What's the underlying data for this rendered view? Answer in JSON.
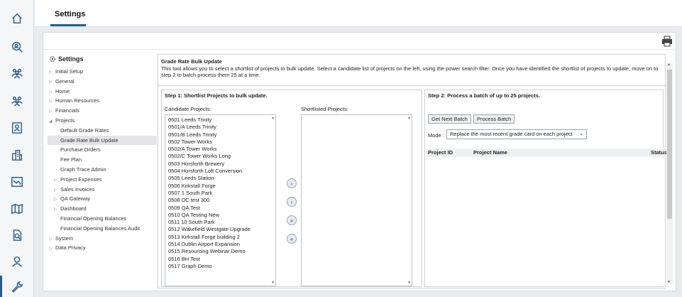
{
  "rail": {
    "icons": [
      "home-icon",
      "search-people-icon",
      "team-icon",
      "group-icon",
      "contact-card-icon",
      "buildings-icon",
      "chart-icon",
      "map-icon",
      "document-search-icon",
      "user-icon",
      "wrench-icon"
    ]
  },
  "header": {
    "tab_label": "Settings"
  },
  "tree": {
    "title": "Settings",
    "items": [
      {
        "label": "Initial Setup",
        "arrow": "▷"
      },
      {
        "label": "General",
        "arrow": "▷"
      },
      {
        "label": "Home",
        "arrow": "▷"
      },
      {
        "label": "Human Resources",
        "arrow": "▷"
      },
      {
        "label": "Financials",
        "arrow": "▷"
      },
      {
        "label": "Projects",
        "arrow": "◢"
      },
      {
        "label": "Default Grade Rates",
        "arrow": ""
      },
      {
        "label": "Grade Rate Bulk Update",
        "arrow": ""
      },
      {
        "label": "Purchase Orders",
        "arrow": ""
      },
      {
        "label": "Fee Plan",
        "arrow": ""
      },
      {
        "label": "Graph Trace Admin",
        "arrow": ""
      },
      {
        "label": "Project Expenses",
        "arrow": "▷"
      },
      {
        "label": "Sales Invoices",
        "arrow": "▷"
      },
      {
        "label": "QA Gateway",
        "arrow": "▷"
      },
      {
        "label": "Dashboard",
        "arrow": "▷"
      },
      {
        "label": "Financial Opening Balances",
        "arrow": ""
      },
      {
        "label": "Financial Opening Balances Audit",
        "arrow": ""
      },
      {
        "label": "System",
        "arrow": "▷"
      },
      {
        "label": "Data Privacy",
        "arrow": "▷"
      }
    ]
  },
  "tool": {
    "heading": "Grade Rate Bulk Update",
    "description": "This tool allows you to select a shortlist of projects to bulk update. Select a candidate list of projects on the left, using the power search filter. Once you have identified the shortlist of projects to update, move on to step 2 to batch process them 25 at a time."
  },
  "step1": {
    "title": "Step 1: Shortlist Projects to bulk update.",
    "candidate_label": "Candidate Projects:",
    "shortlist_label": "Shortlisted Projects:",
    "candidates": [
      "0501 Leeds Trinity",
      "0501/A Leeds Trinity",
      "0501/B Leeds Trinity",
      "0502 Tower Works",
      "0502/A Tower Works",
      "0502/C Tower Works Long",
      "0503 Horsforth Brewery",
      "0504 Horsforth Loft Conversion",
      "0505 Leeds Station",
      "0506 Kirkstall Forge",
      "0507 1 South Park",
      "0508 DC test 300",
      "0509 QA Test",
      "0510 QA Testing New",
      "0511 10 South Park",
      "0512 Wakefield Westgate Upgrade",
      "0513 Kirkstall Forge building 2",
      "0514 Dublin Airport Expansion",
      "0515 Resourcing Webinar Demo",
      "0516 BH Test",
      "0517 Graph Demo"
    ],
    "move_buttons": [
      {
        "symbol": "›",
        "name": "move-right-button"
      },
      {
        "symbol": "‹",
        "name": "move-left-button"
      },
      {
        "symbol": "»",
        "name": "move-all-right-button"
      },
      {
        "symbol": "«",
        "name": "move-all-left-button"
      }
    ]
  },
  "step2": {
    "title": "Step 2: Process a batch of up to 25 projects.",
    "get_next_batch": "Get Next Batch",
    "process_batch": "Process Batch",
    "mode_label": "Mode :",
    "mode_value": "Replace the most recent grade card on each project",
    "columns": [
      "Project ID",
      "Project Name",
      "Status"
    ]
  }
}
